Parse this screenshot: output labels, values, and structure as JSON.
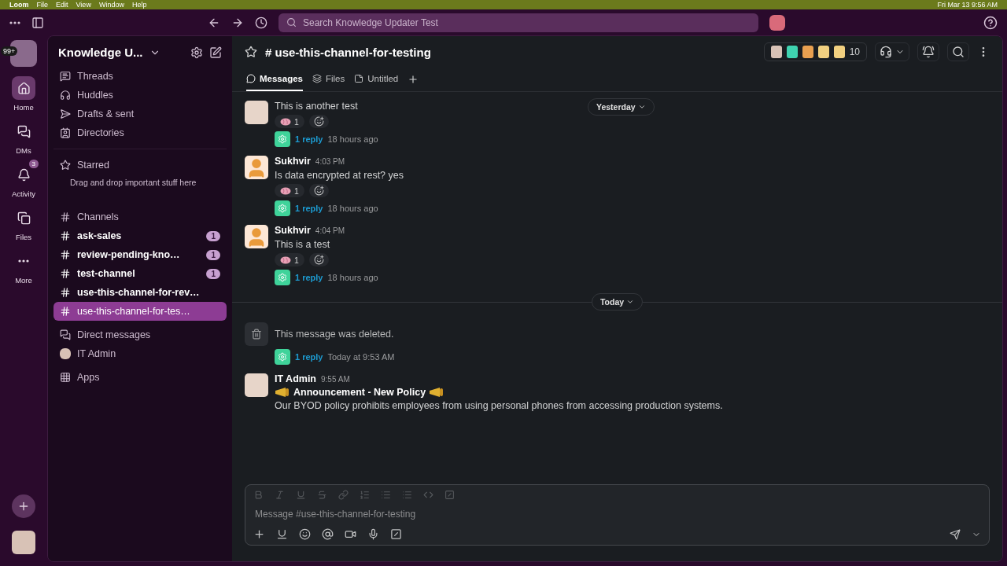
{
  "menubar": {
    "app": "Loom",
    "menus": [
      "File",
      "Edit",
      "View",
      "Window",
      "Help"
    ],
    "clock": "Fri Mar 13  9:56 AM"
  },
  "search": {
    "placeholder": "Search Knowledge Updater Test"
  },
  "rail": {
    "workspace_badge": "99+",
    "items": [
      {
        "label": "Home",
        "selected": true
      },
      {
        "label": "DMs",
        "selected": false
      },
      {
        "label": "Activity",
        "selected": false,
        "badge": "3"
      },
      {
        "label": "Files",
        "selected": false
      },
      {
        "label": "More",
        "selected": false
      }
    ]
  },
  "sidebar": {
    "workspace": "Knowledge U...",
    "nav": [
      {
        "label": "Threads"
      },
      {
        "label": "Huddles"
      },
      {
        "label": "Drafts & sent"
      },
      {
        "label": "Directories"
      }
    ],
    "starred": {
      "title": "Starred",
      "hint": "Drag and drop important stuff here"
    },
    "channels": {
      "title": "Channels",
      "items": [
        {
          "name": "ask-sales",
          "count": "1",
          "unread": true,
          "selected": false
        },
        {
          "name": "review-pending-kno…",
          "count": "1",
          "unread": true,
          "selected": false
        },
        {
          "name": "test-channel",
          "count": "1",
          "unread": true,
          "selected": false
        },
        {
          "name": "use-this-channel-for-rev…",
          "unread": true,
          "selected": false
        },
        {
          "name": "use-this-channel-for-tes…",
          "unread": false,
          "selected": true
        }
      ]
    },
    "direct_messages": {
      "title": "Direct messages",
      "items": [
        {
          "name": "IT Admin"
        }
      ]
    },
    "apps": "Apps"
  },
  "channel": {
    "title": "# use-this-channel-for-testing",
    "member_count": "10",
    "tabs": [
      {
        "label": "Messages",
        "selected": true
      },
      {
        "label": "Files",
        "selected": false
      },
      {
        "label": "Untitled",
        "selected": false
      }
    ]
  },
  "messages": [
    {
      "kind": "message",
      "text": "This is another test",
      "reaction": "1",
      "reply": "1 reply",
      "reply_time": "18 hours ago",
      "day": "Yesterday"
    },
    {
      "kind": "message",
      "author": "Sukhvir",
      "time": "4:03 PM",
      "text": "Is data encrypted at rest? yes",
      "reaction": "1",
      "reply": "1 reply",
      "reply_time": "18 hours ago"
    },
    {
      "kind": "message",
      "author": "Sukhvir",
      "time": "4:04 PM",
      "text": "This is a test",
      "reaction": "1",
      "reply": "1 reply",
      "reply_time": "18 hours ago"
    },
    {
      "kind": "divider",
      "label": "Today"
    },
    {
      "kind": "deleted",
      "text": "This message was deleted.",
      "reply": "1 reply",
      "reply_time": "Today at 9:53 AM"
    },
    {
      "kind": "announcement",
      "author": "IT Admin",
      "time": "9:55 AM",
      "title": "Announcement - New Policy",
      "text": "Our BYOD policy prohibits employees from using personal phones from accessing production systems."
    }
  ],
  "composer": {
    "placeholder": "Message #use-this-channel-for-testing"
  }
}
